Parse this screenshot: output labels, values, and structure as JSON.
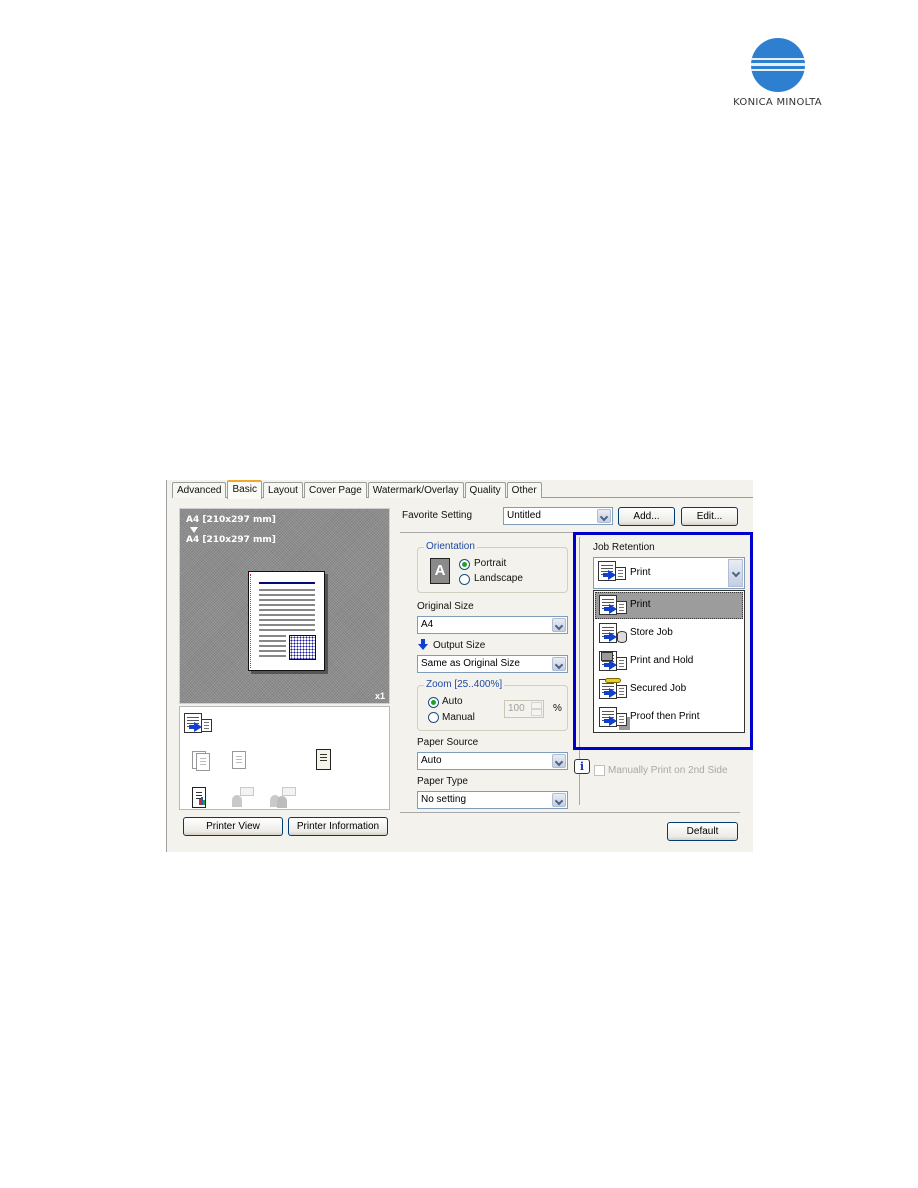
{
  "logo": {
    "brand": "KONICA MINOLTA",
    "color": "#2f7fd0"
  },
  "tabs": [
    {
      "label": "Advanced",
      "active": false
    },
    {
      "label": "Basic",
      "active": true
    },
    {
      "label": "Layout",
      "active": false
    },
    {
      "label": "Cover Page",
      "active": false
    },
    {
      "label": "Watermark/Overlay",
      "active": false
    },
    {
      "label": "Quality",
      "active": false
    },
    {
      "label": "Other",
      "active": false
    }
  ],
  "preview": {
    "original_size": "A4 [210x297 mm]",
    "output_size": "A4 [210x297 mm]",
    "copies_label": "x1"
  },
  "function_icons": [
    "print-job-icon",
    "collate-icon",
    "single-copy-icon",
    "booklet-icon",
    "color-document-icon",
    "user-auth-icon",
    "account-track-icon"
  ],
  "left_buttons": {
    "printer_view": "Printer View",
    "printer_information": "Printer Information"
  },
  "favorite": {
    "label": "Favorite Setting",
    "value": "Untitled",
    "add": "Add...",
    "edit": "Edit..."
  },
  "orientation": {
    "title": "Orientation",
    "options": [
      {
        "label": "Portrait",
        "selected": true
      },
      {
        "label": "Landscape",
        "selected": false
      }
    ],
    "icon_letter": "A"
  },
  "original_size": {
    "label": "Original Size",
    "value": "A4"
  },
  "output_size": {
    "label": "Output Size",
    "value": "Same as Original Size"
  },
  "zoom": {
    "title": "Zoom [25..400%]",
    "options": [
      {
        "label": "Auto",
        "selected": true
      },
      {
        "label": "Manual",
        "selected": false
      }
    ],
    "value": "100",
    "unit": "%"
  },
  "paper_source": {
    "label": "Paper Source",
    "value": "Auto"
  },
  "paper_type": {
    "label": "Paper Type",
    "value": "No setting"
  },
  "job_retention": {
    "label": "Job Retention",
    "value": "Print",
    "highlight_color": "#0000cc",
    "options": [
      {
        "label": "Print",
        "icon": "print-icon",
        "selected": true
      },
      {
        "label": "Store Job",
        "icon": "store-job-icon",
        "selected": false
      },
      {
        "label": "Print and Hold",
        "icon": "print-and-hold-icon",
        "selected": false
      },
      {
        "label": "Secured Job",
        "icon": "secured-job-icon",
        "selected": false
      },
      {
        "label": "Proof then Print",
        "icon": "proof-then-print-icon",
        "selected": false
      }
    ]
  },
  "manual_duplex": {
    "label": "Manually Print on 2nd Side",
    "checked": false,
    "enabled": false
  },
  "info_icon_text": "i",
  "default_button": "Default"
}
